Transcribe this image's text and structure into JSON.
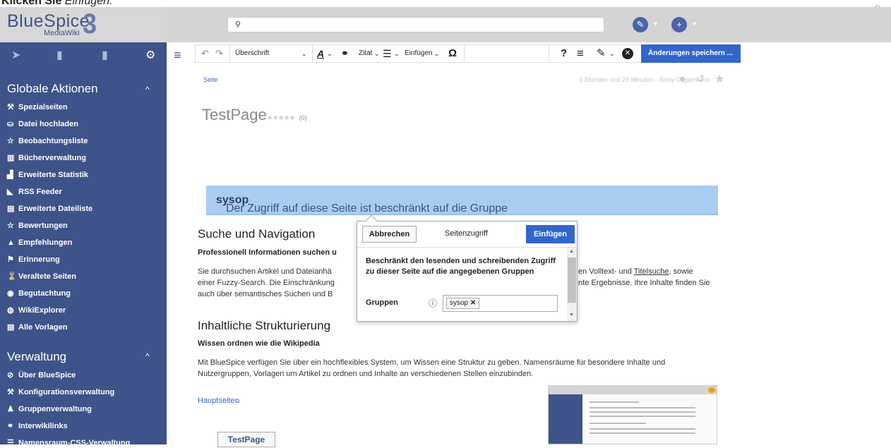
{
  "caption": {
    "bold": "Klicken Sie",
    "italic": "Einfügen."
  },
  "header": {
    "logo_text": "BlueSpice",
    "logo_sub": "MediaWiki",
    "logo_num": "3",
    "search_icon": "search-icon",
    "edit_icon": "pencil-icon",
    "add_icon": "plus-icon"
  },
  "sidebar": {
    "tool_icons": [
      "navigation-icon",
      "book-icon",
      "clipboard-icon",
      "gear-icon"
    ],
    "sections": [
      {
        "title": "Globale Aktionen",
        "items": [
          {
            "icon": "wrench-icon",
            "glyph": "⚒",
            "label": "Spezialseiten"
          },
          {
            "icon": "upload-icon",
            "glyph": "⛀",
            "label": "Datei hochladen"
          },
          {
            "icon": "star-icon",
            "glyph": "☆",
            "label": "Beobachtungsliste"
          },
          {
            "icon": "books-icon",
            "glyph": "▥",
            "label": "Bücherverwaltung"
          },
          {
            "icon": "chart-icon",
            "glyph": "▟",
            "label": "Erweiterte Statistik"
          },
          {
            "icon": "rss-icon",
            "glyph": "◣",
            "label": "RSS Feeder"
          },
          {
            "icon": "list-icon",
            "glyph": "▤",
            "label": "Erweiterte Dateiliste"
          },
          {
            "icon": "star-icon",
            "glyph": "☆",
            "label": "Bewertungen"
          },
          {
            "icon": "thumb-icon",
            "glyph": "▲",
            "label": "Empfehlungen"
          },
          {
            "icon": "flag-icon",
            "glyph": "⚑",
            "label": "Erinnerung"
          },
          {
            "icon": "hourglass-icon",
            "glyph": "⌛",
            "label": "Veraltete Seiten"
          },
          {
            "icon": "eye-icon",
            "glyph": "◉",
            "label": "Begutachtung"
          },
          {
            "icon": "globe-icon",
            "glyph": "◍",
            "label": "WikiExplorer"
          },
          {
            "icon": "template-icon",
            "glyph": "▤",
            "label": "Alle Vorlagen"
          }
        ]
      },
      {
        "title": "Verwaltung",
        "items": [
          {
            "icon": "info-icon",
            "glyph": "⊘",
            "label": "Über BlueSpice"
          },
          {
            "icon": "wrench-icon",
            "glyph": "⚒",
            "label": "Konfigurationsverwaltung"
          },
          {
            "icon": "group-icon",
            "glyph": "♟",
            "label": "Gruppenverwaltung"
          },
          {
            "icon": "link-icon",
            "glyph": "⚭",
            "label": "Interwikilinks"
          },
          {
            "icon": "css-icon",
            "glyph": "☰",
            "label": "Namensraum-CSS-Verwaltung"
          }
        ]
      }
    ]
  },
  "toolbar": {
    "undo": "↶",
    "redo": "↷",
    "heading": "Überschrift",
    "text_style": "A",
    "link": "⚭",
    "cite": "Zitat",
    "list": "☰",
    "insert": "Einfügen",
    "special_char": "Ω",
    "help": "?",
    "page_options": "≡",
    "edit_mode": "✎",
    "close": "✕",
    "save": "Änderungen speichern ..."
  },
  "content": {
    "breadcrumb": "Seite",
    "meta": "3 Stunden und 28 Minuten - Sissy Oppermann",
    "title": "TestPage",
    "stars": "★★★★★",
    "rating_count": "(0)",
    "banner_text": "Der Zugriff auf diese Seite ist beschränkt auf die Gruppe",
    "banner_group": "sysop",
    "banner_end": ".",
    "s1_title": "Suche und Navigation",
    "s1_sub": "Professionell Informationen suchen u",
    "s1_p1a": "Sie durchsuchen Artikel und Dateianhä",
    "s1_p1b": "en Volltext- und",
    "s1_p1link": "Titelsuche",
    "s1_p1c": ", sowie",
    "s1_p2a": "einer Fuzzy-Search. Die Einschränkung",
    "s1_p2b": "nte Ergebnisse. Ihre Inhalte finden Sie",
    "s1_p3a": "auch über semantisches Suchen und B",
    "s2_title": "Inhaltliche Strukturierung",
    "s2_sub": "Wissen ordnen wie die Wikipedia",
    "s2_p1": "Mit BlueSpice verfügen Sie über ein hochflexibles System, um Wissen eine Struktur zu geben. Namensräume für besondere Inhalte und",
    "s2_p2": "Nutzergruppen, Vorlagen um Artikel zu ordnen und Inhalte an verschiedenen Stellen einzubinden.",
    "main_link": "Hauptseite",
    "testpage_button": "TestPage"
  },
  "popup": {
    "cancel": "Abbrechen",
    "title": "Seitenzugriff",
    "insert": "Einfügen",
    "description_line1": "Beschränkt den lesenden und schreibenden Zugriff",
    "description_line2": "zu dieser Seite auf die angegebenen Gruppen",
    "groups_label": "Gruppen",
    "group_tag": "sysop"
  },
  "colors": {
    "sidebar": "#3e5389",
    "accent": "#3366cc",
    "banner": "#a9cdf0",
    "topbar": "#d4d4d4"
  }
}
